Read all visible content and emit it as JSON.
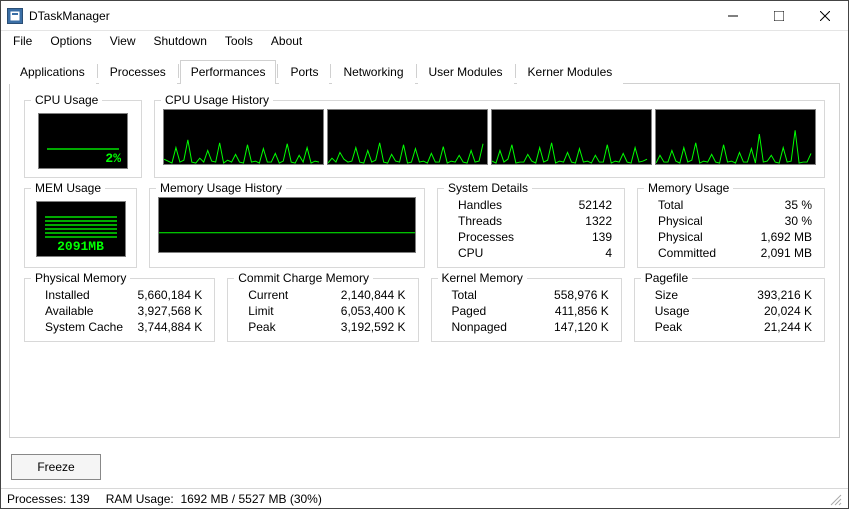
{
  "window": {
    "title": "DTaskManager"
  },
  "menu": {
    "file": "File",
    "options": "Options",
    "view": "View",
    "shutdown": "Shutdown",
    "tools": "Tools",
    "about": "About"
  },
  "tabs": {
    "applications": "Applications",
    "processes": "Processes",
    "performances": "Performances",
    "ports": "Ports",
    "networking": "Networking",
    "user_modules": "User Modules",
    "kerner_modules": "Kerner Modules"
  },
  "labels": {
    "cpu_usage": "CPU Usage",
    "cpu_history": "CPU Usage History",
    "mem_usage": "MEM Usage",
    "mem_history": "Memory Usage History",
    "system_details": "System Details",
    "memory_usage": "Memory Usage",
    "physical_memory": "Physical Memory",
    "commit_charge": "Commit Charge Memory",
    "kernel_memory": "Kernel Memory",
    "pagefile": "Pagefile",
    "handles": "Handles",
    "threads": "Threads",
    "processes": "Processes",
    "cpu": "CPU",
    "total": "Total",
    "physical": "Physical",
    "physical_mb": "Physical",
    "committed": "Committed",
    "installed": "Installed",
    "available": "Available",
    "system_cache": "System Cache",
    "current": "Current",
    "limit": "Limit",
    "peak": "Peak",
    "paged": "Paged",
    "nonpaged": "Nonpaged",
    "size": "Size",
    "usage": "Usage"
  },
  "values": {
    "cpu_pct": "2%",
    "mem_mb": "2091MB",
    "handles": "52142",
    "threads": "1322",
    "processes": "139",
    "cpu_count": "4",
    "mem_total": "35 %",
    "mem_physical": "30 %",
    "mem_physical_mb": "1,692 MB",
    "mem_committed": "2,091 MB",
    "pm_installed": "5,660,184 K",
    "pm_available": "3,927,568 K",
    "pm_cache": "3,744,884 K",
    "cc_current": "2,140,844 K",
    "cc_limit": "6,053,400 K",
    "cc_peak": "3,192,592 K",
    "km_total": "558,976 K",
    "km_paged": "411,856 K",
    "km_nonpaged": "147,120 K",
    "pf_size": "393,216 K",
    "pf_usage": "20,024 K",
    "pf_peak": "21,244 K"
  },
  "buttons": {
    "freeze": "Freeze"
  },
  "status": {
    "processes_lbl": "Processes:",
    "processes_val": "139",
    "ram_lbl": "RAM Usage:",
    "ram_val": "1692 MB / 5527 MB (30%)"
  },
  "chart_data": [
    {
      "type": "gauge",
      "title": "CPU Usage",
      "value": 2,
      "unit": "%",
      "range": [
        0,
        100
      ]
    },
    {
      "type": "gauge",
      "title": "MEM Usage",
      "value": 2091,
      "unit": "MB",
      "range": [
        0,
        5527
      ]
    },
    {
      "type": "line",
      "title": "CPU Usage History core 0",
      "ylabel": "%",
      "ylim": [
        0,
        100
      ],
      "x": [
        0,
        1,
        2,
        3,
        4,
        5,
        6,
        7,
        8,
        9,
        10,
        11,
        12,
        13,
        14,
        15,
        16,
        17,
        18,
        19,
        20,
        21,
        22,
        23,
        24,
        25,
        26,
        27,
        28,
        29,
        30,
        31,
        32,
        33,
        34,
        35,
        36,
        37,
        38,
        39
      ],
      "values": [
        8,
        5,
        2,
        30,
        3,
        6,
        45,
        4,
        2,
        10,
        3,
        25,
        5,
        3,
        40,
        2,
        6,
        3,
        18,
        4,
        2,
        35,
        3,
        5,
        2,
        28,
        4,
        3,
        20,
        2,
        5,
        38,
        3,
        2,
        15,
        4,
        30,
        2,
        5,
        3
      ]
    },
    {
      "type": "line",
      "title": "CPU Usage History core 1",
      "ylabel": "%",
      "ylim": [
        0,
        100
      ],
      "x": [
        0,
        1,
        2,
        3,
        4,
        5,
        6,
        7,
        8,
        9,
        10,
        11,
        12,
        13,
        14,
        15,
        16,
        17,
        18,
        19,
        20,
        21,
        22,
        23,
        24,
        25,
        26,
        27,
        28,
        29,
        30,
        31,
        32,
        33,
        34,
        35,
        36,
        37,
        38,
        39
      ],
      "values": [
        2,
        10,
        3,
        22,
        8,
        3,
        5,
        30,
        4,
        2,
        25,
        3,
        6,
        40,
        3,
        2,
        18,
        5,
        3,
        35,
        2,
        4,
        28,
        3,
        5,
        2,
        20,
        4,
        3,
        32,
        2,
        5,
        3,
        15,
        4,
        2,
        25,
        3,
        5,
        38
      ]
    },
    {
      "type": "line",
      "title": "CPU Usage History core 2",
      "ylabel": "%",
      "ylim": [
        0,
        100
      ],
      "x": [
        0,
        1,
        2,
        3,
        4,
        5,
        6,
        7,
        8,
        9,
        10,
        11,
        12,
        13,
        14,
        15,
        16,
        17,
        18,
        19,
        20,
        21,
        22,
        23,
        24,
        25,
        26,
        27,
        28,
        29,
        30,
        31,
        32,
        33,
        34,
        35,
        36,
        37,
        38,
        39
      ],
      "values": [
        5,
        2,
        25,
        3,
        8,
        35,
        2,
        4,
        3,
        18,
        5,
        2,
        30,
        3,
        6,
        40,
        2,
        5,
        3,
        22,
        4,
        2,
        28,
        3,
        5,
        2,
        15,
        4,
        3,
        35,
        2,
        5,
        3,
        20,
        4,
        2,
        30,
        3,
        5,
        8
      ]
    },
    {
      "type": "line",
      "title": "CPU Usage History core 3",
      "ylabel": "%",
      "ylim": [
        0,
        100
      ],
      "x": [
        0,
        1,
        2,
        3,
        4,
        5,
        6,
        7,
        8,
        9,
        10,
        11,
        12,
        13,
        14,
        15,
        16,
        17,
        18,
        19,
        20,
        21,
        22,
        23,
        24,
        25,
        26,
        27,
        28,
        29,
        30,
        31,
        32,
        33,
        34,
        35,
        36,
        37,
        38,
        39
      ],
      "values": [
        2,
        15,
        4,
        3,
        25,
        5,
        2,
        30,
        3,
        6,
        40,
        2,
        5,
        3,
        18,
        4,
        2,
        35,
        3,
        5,
        2,
        22,
        4,
        3,
        28,
        2,
        55,
        3,
        5,
        15,
        4,
        2,
        30,
        3,
        5,
        62,
        2,
        4,
        3,
        20
      ]
    },
    {
      "type": "line",
      "title": "Memory Usage History",
      "ylabel": "%",
      "ylim": [
        0,
        100
      ],
      "x": [
        0,
        1,
        2,
        3,
        4,
        5,
        6,
        7,
        8,
        9,
        10,
        11,
        12,
        13,
        14,
        15,
        16,
        17,
        18,
        19
      ],
      "values": [
        35,
        35,
        35,
        35,
        35,
        35,
        35,
        35,
        35,
        35,
        35,
        35,
        35,
        35,
        35,
        35,
        35,
        35,
        35,
        35
      ]
    }
  ]
}
